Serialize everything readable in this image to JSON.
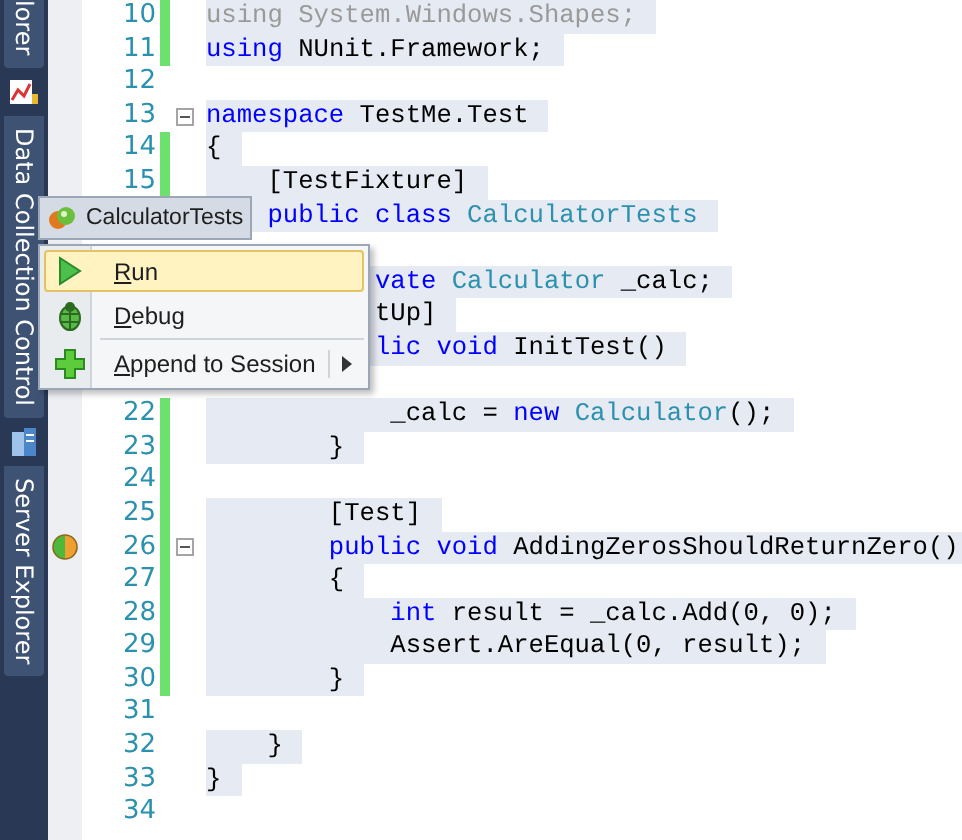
{
  "sidebar": {
    "tabs": [
      {
        "label": "lorer",
        "kind": "text"
      },
      {
        "kind": "chart-icon"
      },
      {
        "label": "Data Collection Control",
        "kind": "text"
      },
      {
        "kind": "server-icon"
      },
      {
        "label": "Server Explorer",
        "kind": "text"
      }
    ]
  },
  "editor": {
    "lines": [
      {
        "number": "10",
        "changed": true,
        "tokens": [
          {
            "text": "using System.Windows.Shapes;",
            "kind": "faded"
          }
        ]
      },
      {
        "number": "11",
        "changed": true,
        "tokens": [
          {
            "text": "using",
            "kind": "keyword"
          },
          {
            "text": " NUnit.Framework;",
            "kind": "plain"
          }
        ]
      },
      {
        "number": "12",
        "changed": false
      },
      {
        "number": "13",
        "changed": false,
        "fold": true,
        "tokens": [
          {
            "text": "namespace",
            "kind": "keyword"
          },
          {
            "text": " TestMe.Test",
            "kind": "plain"
          }
        ]
      },
      {
        "number": "14",
        "changed": true,
        "tokens": [
          {
            "text": "{",
            "kind": "plain"
          }
        ]
      },
      {
        "number": "15",
        "changed": true,
        "tokens": [
          {
            "text": "    [TestFixture]",
            "kind": "plain"
          }
        ]
      },
      {
        "tokens": [
          {
            "text": "    public class",
            "kind": "keyword"
          },
          {
            "text": " CalculatorTests",
            "kind": "type"
          }
        ]
      },
      {
        "covered": true
      },
      {
        "tokens": [
          {
            "text": "           vate",
            "kind": "keyword"
          },
          {
            "text": " Calculator",
            "kind": "type"
          },
          {
            "text": " _calc;",
            "kind": "plain"
          }
        ]
      },
      {
        "tokens": [
          {
            "text": "           tUp]",
            "kind": "plain"
          }
        ]
      },
      {
        "tokens": [
          {
            "text": "           lic void",
            "kind": "keyword"
          },
          {
            "text": " InitTest()",
            "kind": "plain"
          }
        ]
      },
      {
        "covered": true
      },
      {
        "number": "22",
        "changed": true,
        "tokens": [
          {
            "text": "            _calc = ",
            "kind": "plain"
          },
          {
            "text": "new",
            "kind": "keyword"
          },
          {
            "text": " Calculator",
            "kind": "type"
          },
          {
            "text": "();",
            "kind": "plain"
          }
        ]
      },
      {
        "number": "23",
        "changed": true,
        "tokens": [
          {
            "text": "        }",
            "kind": "plain"
          }
        ]
      },
      {
        "number": "24",
        "changed": true
      },
      {
        "number": "25",
        "changed": true,
        "tokens": [
          {
            "text": "        [Test]",
            "kind": "plain"
          }
        ]
      },
      {
        "number": "26",
        "changed": true,
        "fold": true,
        "test_marker": true,
        "tokens": [
          {
            "text": "        public void",
            "kind": "keyword"
          },
          {
            "text": " AddingZerosShouldReturnZero()",
            "kind": "plain"
          }
        ]
      },
      {
        "number": "27",
        "changed": true,
        "tokens": [
          {
            "text": "        {",
            "kind": "plain"
          }
        ]
      },
      {
        "number": "28",
        "changed": true,
        "tokens": [
          {
            "text": "            int",
            "kind": "keyword"
          },
          {
            "text": " result = _calc.Add(0, 0);",
            "kind": "plain"
          }
        ]
      },
      {
        "number": "29",
        "changed": true,
        "tokens": [
          {
            "text": "            Assert.AreEqual(0, result);",
            "kind": "plain"
          }
        ]
      },
      {
        "number": "30",
        "changed": true,
        "tokens": [
          {
            "text": "        }",
            "kind": "plain"
          }
        ]
      },
      {
        "number": "31",
        "changed": false
      },
      {
        "number": "32",
        "changed": false,
        "tokens": [
          {
            "text": "    }",
            "kind": "plain"
          }
        ]
      },
      {
        "number": "33",
        "changed": false,
        "tokens": [
          {
            "text": "}",
            "kind": "plain"
          }
        ]
      },
      {
        "number": "34",
        "changed": false
      }
    ]
  },
  "popup": {
    "title": "CalculatorTests",
    "items": [
      {
        "label": "Run",
        "kind": "play",
        "selected": true,
        "submenu": false
      },
      {
        "label": "Debug",
        "kind": "bug",
        "selected": false,
        "submenu": false
      },
      {
        "label": "Append to Session",
        "kind": "plus",
        "selected": false,
        "submenu": true
      }
    ]
  }
}
